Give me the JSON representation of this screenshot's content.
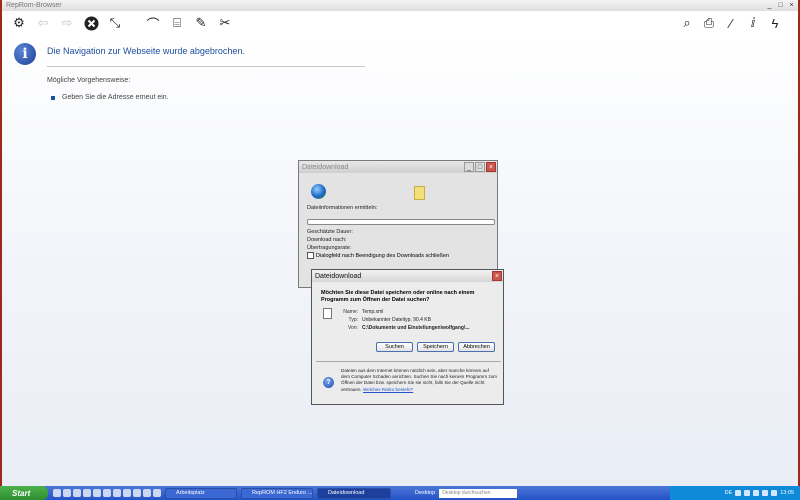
{
  "window": {
    "title": "RepRom-Browser",
    "controls": [
      "_",
      "□",
      "×"
    ]
  },
  "toolbar": {
    "left_icons": [
      "settings-icon",
      "back-icon",
      "forward-icon",
      "stop-icon",
      "refresh-icon",
      "antenna-icon",
      "tool-icon",
      "microphone-icon",
      "wrench-icon"
    ],
    "right_icons": [
      "search-icon",
      "print-icon",
      "edit-icon",
      "zoom-icon",
      "lightning-icon"
    ]
  },
  "content": {
    "info_glyph": "i",
    "title": "Die Navigation zur Webseite wurde abgebrochen.",
    "possible": "Mögliche Vorgehensweise:",
    "bullet": "Geben Sie die Adresse erneut ein."
  },
  "dialog_back": {
    "title": "Dateidownload",
    "controls": [
      "_",
      "□",
      "×"
    ],
    "info": "Dateiinformationen ermitteln:",
    "remaining": "Geschätzte Dauer:",
    "download_to": "Download nach:",
    "rate": "Übertragungsrate:",
    "checkbox": "Dialogfeld nach Beendigung des Downloads schließen"
  },
  "dialog_front": {
    "title": "Dateidownload",
    "close": "×",
    "question": "Möchten Sie diese Datei speichern oder online nach einem Programm zum Öffnen der Datei suchen?",
    "name_k": "Name:",
    "name_v": "Temp.xml",
    "type_k": "Typ:",
    "type_v": "Unbekannter Dateityp, 90,4 KB",
    "from_k": "Von:",
    "from_v": "C:\\Dokumente und Einstellungen\\wolfgang\\...",
    "btn_search": "Suchen",
    "btn_save": "Speichern",
    "btn_cancel": "Abbrechen",
    "shield_glyph": "?",
    "warning": "Dateien aus dem Internet können nützlich sein, aber manche können auf dem Computer Schaden anrichten. Suchen Sie nach keinem Programm zum Öffnen der Datei bzw. speichern Sie sie nicht, falls Sie der Quelle nicht vertrauen.",
    "warning_link": "Welches Risiko besteht?"
  },
  "taskbar": {
    "start": "Start",
    "tasks": [
      "Arbeitsplatz",
      "RepROM HF2 Enduro ...",
      "Dateidownload"
    ],
    "desktop": "Desktop",
    "search_placeholder": "Desktop durchsuchen",
    "lang": "DE",
    "clock": "13:05"
  }
}
